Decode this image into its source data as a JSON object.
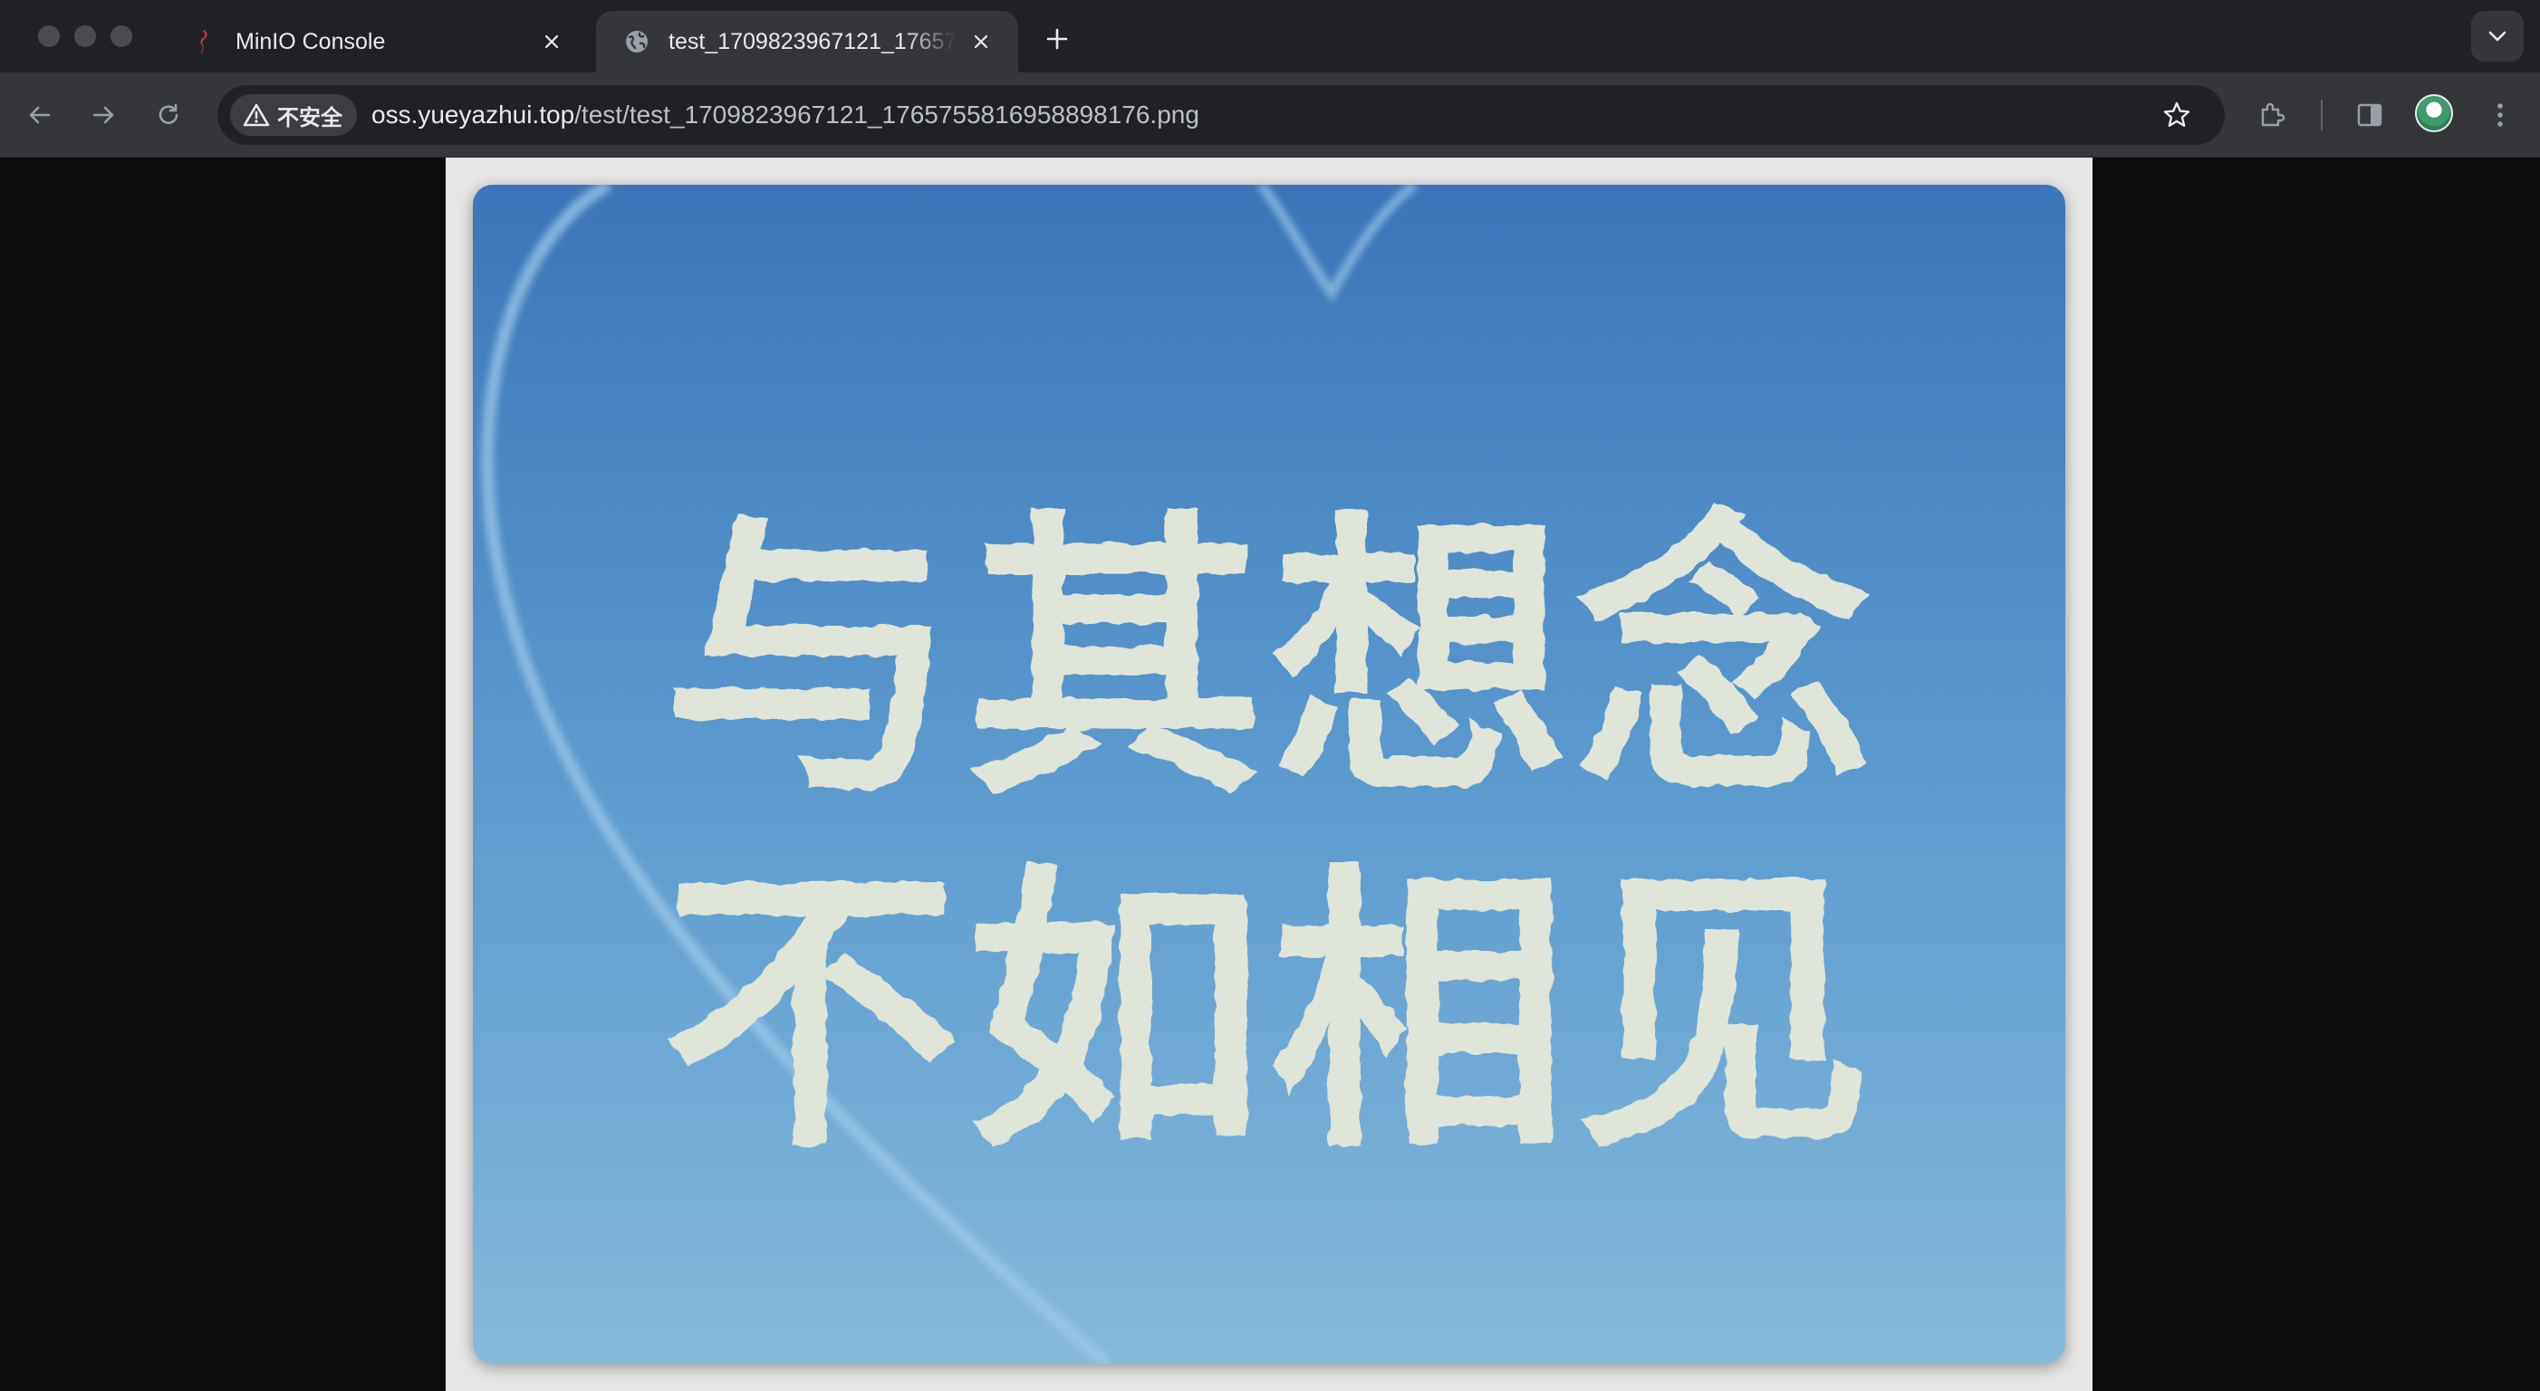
{
  "browser": {
    "tabs": [
      {
        "title": "MinIO Console",
        "icon": "minio-flamingo-icon",
        "active": false
      },
      {
        "title": "test_1709823967121_1765755816958898176.png",
        "icon": "globe-icon",
        "active": true
      }
    ],
    "address_bar": {
      "security_label": "不安全",
      "url_host": "oss.yueyazhui.top",
      "url_path": "/test/test_1709823967121_1765755816958898176.png"
    }
  },
  "image_content": {
    "calligraphy_line_1": "与其想念",
    "calligraphy_line_2": "不如相见",
    "colors": {
      "sky_top": "#3c76ba",
      "sky_bottom": "#86b9db",
      "brush_text": "#dfe5d9",
      "contrail": "#9cc8e8"
    }
  },
  "colors": {
    "chrome_dark": "#202124",
    "chrome_toolbar": "#35363a",
    "text": "#e8eaed",
    "page_background": "#0b0b0b"
  }
}
